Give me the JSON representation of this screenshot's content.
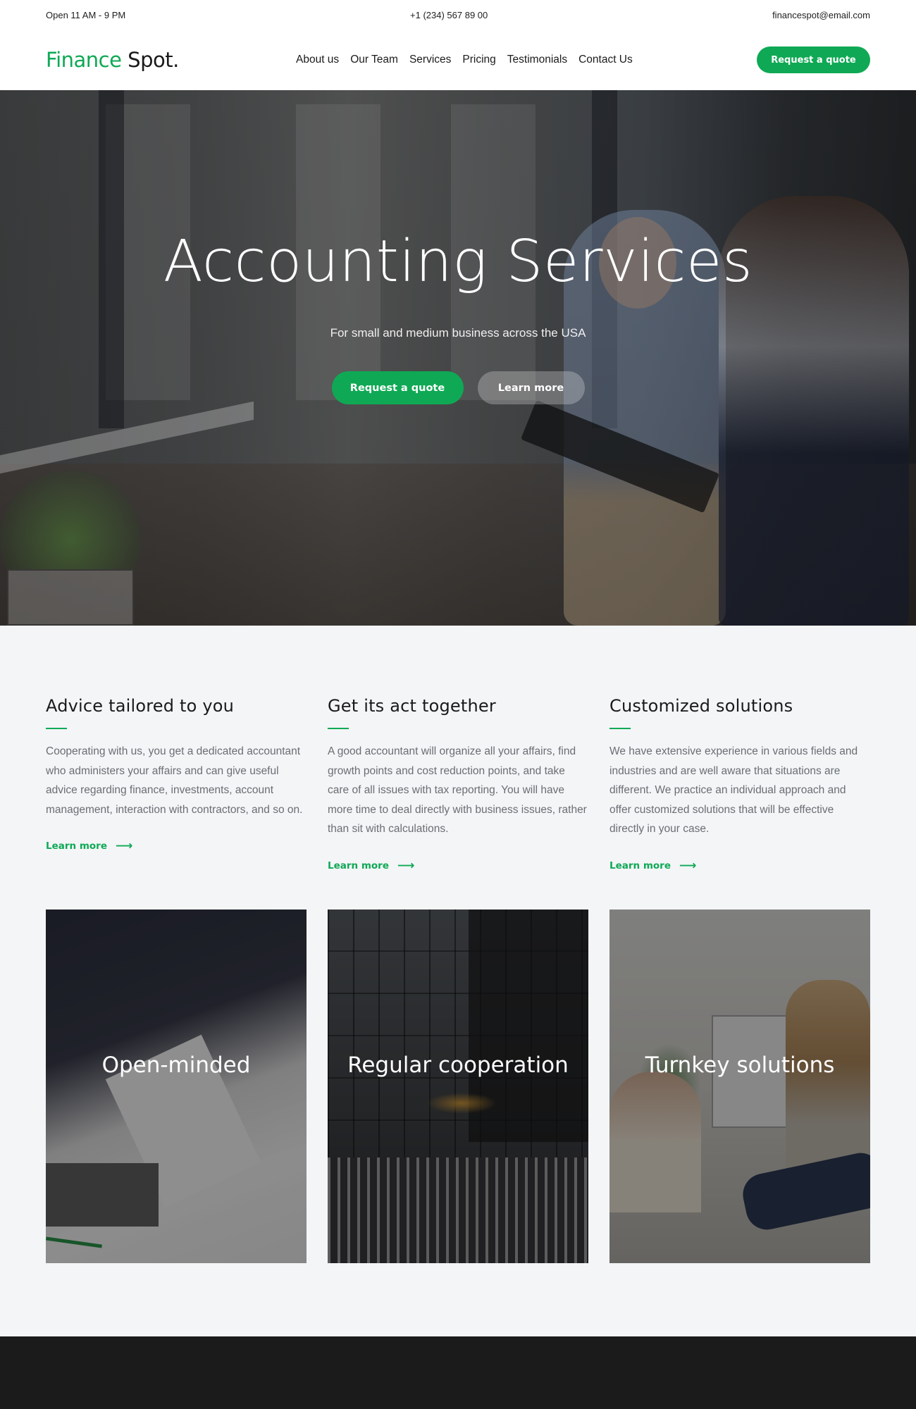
{
  "topbar": {
    "hours": "Open 11 AM - 9 PM",
    "phone": "+1 (234) 567 89 00",
    "email": "financespot@email.com"
  },
  "header": {
    "logo_primary": "Finance",
    "logo_secondary": "Spot.",
    "nav": [
      {
        "label": "About us"
      },
      {
        "label": "Our Team"
      },
      {
        "label": "Services"
      },
      {
        "label": "Pricing"
      },
      {
        "label": "Testimonials"
      },
      {
        "label": "Contact Us"
      }
    ],
    "cta_label": "Request a quote"
  },
  "hero": {
    "title": "Accounting Services",
    "subtitle": "For small and medium business across the USA",
    "primary_button": "Request a quote",
    "secondary_button": "Learn more"
  },
  "features": [
    {
      "title": "Advice tailored to you",
      "body": "Cooperating with us, you get a dedicated accountant who administers your affairs and can give useful advice regarding finance, investments, account management, interaction with contractors, and so on.",
      "link": "Learn more",
      "arrow": "⟶"
    },
    {
      "title": "Get its act together",
      "body": "A good accountant will organize all your affairs, find growth points and cost reduction points, and take care of all issues with tax reporting. You will have more time to deal directly with business issues, rather than sit with calculations.",
      "link": "Learn more",
      "arrow": "⟶"
    },
    {
      "title": "Customized solutions",
      "body": "We have extensive experience in various fields and industries and are well aware that situations are different. We practice an individual approach and offer customized solutions that will be effective directly in your case.",
      "link": "Learn more",
      "arrow": "⟶"
    }
  ],
  "cards": [
    {
      "title": "Open-minded",
      "image": "business-meeting-hands-photo"
    },
    {
      "title": "Regular cooperation",
      "image": "glass-office-building-photo"
    },
    {
      "title": "Turnkey solutions",
      "image": "office-team-photo"
    }
  ],
  "colors": {
    "accent": "#0fa955",
    "footer": "#1b1b1b",
    "section_bg": "#f3f5f7"
  }
}
